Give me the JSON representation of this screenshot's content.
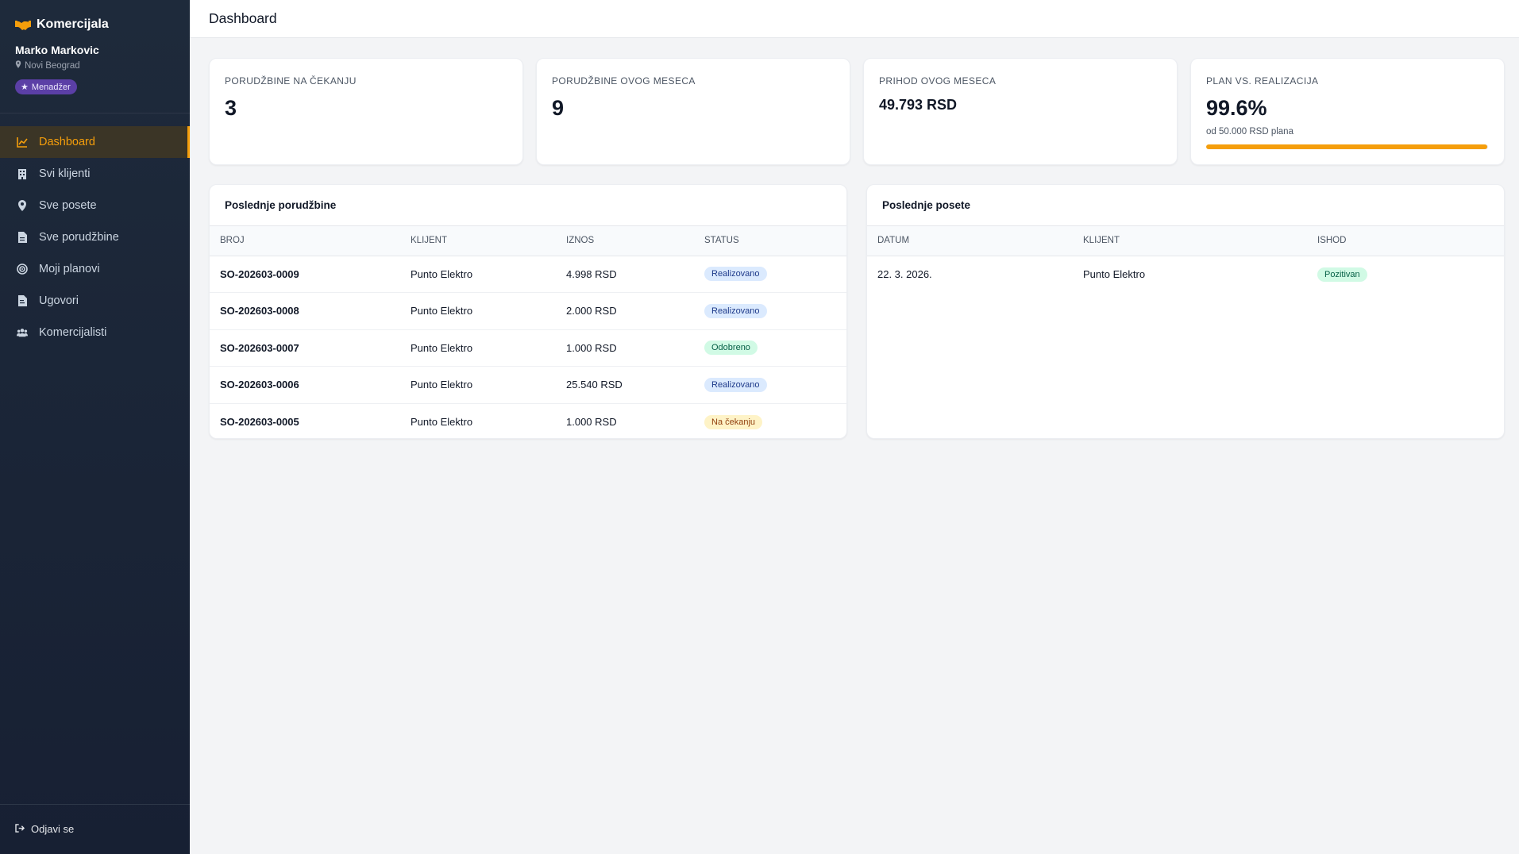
{
  "sidebar": {
    "brand": "Komercijala",
    "user_name": "Marko Markovic",
    "user_location": "Novi Beograd",
    "role": "Menadžer",
    "items": [
      {
        "label": "Dashboard",
        "icon": "chart-line-icon",
        "active": true
      },
      {
        "label": "Svi klijenti",
        "icon": "building-icon"
      },
      {
        "label": "Sve posete",
        "icon": "map-pin-icon"
      },
      {
        "label": "Sve porudžbine",
        "icon": "file-icon"
      },
      {
        "label": "Moji planovi",
        "icon": "target-icon"
      },
      {
        "label": "Ugovori",
        "icon": "file-contract-icon"
      },
      {
        "label": "Komercijalisti",
        "icon": "users-icon"
      }
    ],
    "logout": "Odjavi se"
  },
  "header": {
    "title": "Dashboard"
  },
  "stats": {
    "pending": {
      "label": "Porudžbine na čekanju",
      "value": "3"
    },
    "month_orders": {
      "label": "Porudžbine ovog meseca",
      "value": "9"
    },
    "month_revenue": {
      "label": "Prihod ovog meseca",
      "value": "49.793 RSD"
    },
    "plan": {
      "label": "Plan vs. realizacija",
      "value": "99.6%",
      "sub": "od 50.000 RSD plana",
      "progress": 0.996
    }
  },
  "orders": {
    "title": "Poslednje porudžbine",
    "columns": [
      "Broj",
      "Klijent",
      "Iznos",
      "Status"
    ],
    "rows": [
      {
        "broj": "SO-202603-0009",
        "klijent": "Punto Elektro",
        "iznos": "4.998 RSD",
        "status": "Realizovano",
        "status_type": "blue"
      },
      {
        "broj": "SO-202603-0008",
        "klijent": "Punto Elektro",
        "iznos": "2.000 RSD",
        "status": "Realizovano",
        "status_type": "blue"
      },
      {
        "broj": "SO-202603-0007",
        "klijent": "Punto Elektro",
        "iznos": "1.000 RSD",
        "status": "Odobreno",
        "status_type": "green"
      },
      {
        "broj": "SO-202603-0006",
        "klijent": "Punto Elektro",
        "iznos": "25.540 RSD",
        "status": "Realizovano",
        "status_type": "blue"
      },
      {
        "broj": "SO-202603-0005",
        "klijent": "Punto Elektro",
        "iznos": "1.000 RSD",
        "status": "Na čekanju",
        "status_type": "yellow"
      }
    ]
  },
  "visits": {
    "title": "Poslednje posete",
    "columns": [
      "Datum",
      "Klijent",
      "Ishod"
    ],
    "rows": [
      {
        "datum": "22. 3. 2026.",
        "klijent": "Punto Elektro",
        "ishod": "Pozitivan",
        "ishod_type": "green"
      }
    ]
  },
  "colors": {
    "accent": "#f59e0b",
    "sidebar_bg": "#1e2a3b",
    "role_badge": "#5b3fa6"
  }
}
